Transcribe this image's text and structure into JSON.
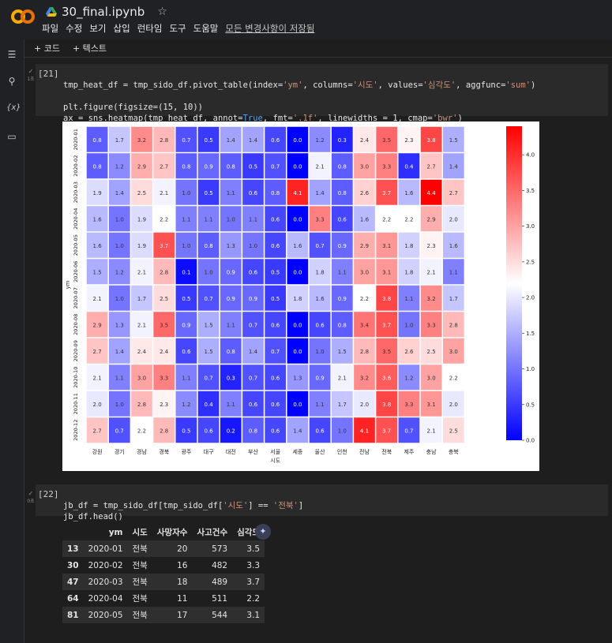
{
  "app": {
    "notebook_title": "30_final.ipynb",
    "menu": [
      "파일",
      "수정",
      "보기",
      "삽입",
      "런타임",
      "도구",
      "도움말"
    ],
    "save_status": "모든 변경사항이 저장됨"
  },
  "toolbar": {
    "code_label": "+ 코드",
    "text_label": "+ 텍스트"
  },
  "cells": [
    {
      "number": "[21]",
      "exec_time": "1초",
      "code_lines": [
        "tmp_heat_df = tmp_sido_df.pivot_table(index='ym', columns='시도', values='심각도', aggfunc='sum')",
        "",
        "plt.figure(figsize=(15, 10))",
        "ax = sns.heatmap(tmp_heat_df, annot=True, fmt='.1f', linewidths = 1, cmap='bwr')"
      ]
    },
    {
      "number": "[22]",
      "exec_time": "0초",
      "code_lines": [
        "jb_df = tmp_sido_df[tmp_sido_df['시도'] == '전북']",
        "jb_df.head()"
      ]
    }
  ],
  "chart_data": {
    "type": "heatmap",
    "xlabel": "시도",
    "ylabel": "ym",
    "x_categories": [
      "강원",
      "경기",
      "경남",
      "경북",
      "광주",
      "대구",
      "대전",
      "부산",
      "서울",
      "세종",
      "울산",
      "인천",
      "전남",
      "전북",
      "제주",
      "충남",
      "충북"
    ],
    "y_categories": [
      "2020-01",
      "2020-02",
      "2020-03",
      "2020-04",
      "2020-05",
      "2020-06",
      "2020-07",
      "2020-08",
      "2020-09",
      "2020-10",
      "2020-11",
      "2020-12"
    ],
    "values": [
      [
        0.8,
        1.7,
        3.2,
        2.8,
        0.7,
        0.5,
        1.4,
        1.4,
        0.6,
        0.0,
        1.2,
        0.3,
        2.4,
        3.5,
        2.3,
        3.8,
        1.5
      ],
      [
        0.8,
        1.2,
        2.9,
        2.7,
        0.8,
        0.9,
        0.8,
        0.5,
        0.7,
        0.0,
        2.1,
        0.8,
        3.0,
        3.3,
        0.4,
        2.7,
        1.4
      ],
      [
        1.9,
        1.4,
        2.5,
        2.1,
        1.0,
        0.5,
        1.1,
        0.6,
        0.8,
        4.1,
        1.4,
        0.8,
        2.6,
        3.7,
        1.6,
        4.4,
        2.7
      ],
      [
        1.6,
        1.0,
        1.9,
        2.2,
        1.1,
        1.1,
        1.0,
        1.1,
        0.6,
        0.0,
        3.3,
        0.6,
        1.6,
        2.2,
        2.2,
        2.9,
        2.0
      ],
      [
        1.6,
        1.0,
        1.9,
        3.7,
        1.0,
        0.8,
        1.3,
        1.0,
        0.6,
        1.6,
        0.7,
        0.9,
        2.9,
        3.1,
        1.8,
        2.3,
        1.6
      ],
      [
        1.5,
        1.2,
        2.1,
        2.8,
        0.1,
        1.0,
        0.9,
        0.6,
        0.5,
        0.0,
        1.8,
        1.1,
        3.0,
        3.1,
        1.8,
        2.1,
        1.1
      ],
      [
        2.1,
        1.0,
        1.7,
        2.5,
        0.5,
        0.7,
        0.9,
        0.9,
        0.5,
        1.8,
        1.6,
        0.9,
        2.2,
        3.8,
        1.1,
        3.2,
        1.7
      ],
      [
        2.9,
        1.3,
        2.1,
        3.5,
        0.9,
        1.5,
        1.1,
        0.7,
        0.6,
        0.0,
        0.6,
        0.8,
        3.4,
        3.7,
        1.0,
        3.3,
        2.8
      ],
      [
        2.7,
        1.4,
        2.4,
        2.4,
        0.6,
        1.5,
        0.8,
        1.4,
        0.7,
        0.0,
        1.0,
        1.5,
        2.8,
        3.5,
        2.6,
        2.5,
        3.0
      ],
      [
        2.1,
        1.1,
        3.0,
        3.3,
        1.1,
        0.7,
        0.3,
        0.7,
        0.6,
        1.3,
        0.9,
        2.1,
        3.2,
        3.6,
        1.2,
        3.0,
        2.2
      ],
      [
        2.0,
        1.0,
        2.8,
        2.3,
        1.2,
        0.4,
        1.1,
        0.6,
        0.6,
        0.0,
        1.1,
        1.7,
        2.0,
        3.8,
        3.3,
        3.1,
        2.0
      ],
      [
        2.7,
        0.7,
        2.2,
        2.8,
        0.5,
        0.6,
        0.2,
        0.8,
        0.6,
        1.4,
        0.6,
        1.0,
        4.1,
        3.7,
        0.7,
        2.1,
        2.5
      ]
    ],
    "colorbar_ticks": [
      "0.0",
      "0.5",
      "1.0",
      "1.5",
      "2.0",
      "2.5",
      "3.0",
      "3.5",
      "4.0"
    ],
    "vmin": 0.0,
    "vmax": 4.4,
    "cmap": "bwr"
  },
  "dataframe": {
    "columns": [
      "ym",
      "시도",
      "사망자수",
      "사고건수",
      "심각도"
    ],
    "rows": [
      {
        "index": "13",
        "ym": "2020-01",
        "sido": "전북",
        "deaths": "20",
        "accidents": "573",
        "severity": "3.5"
      },
      {
        "index": "30",
        "ym": "2020-02",
        "sido": "전북",
        "deaths": "16",
        "accidents": "482",
        "severity": "3.3"
      },
      {
        "index": "47",
        "ym": "2020-03",
        "sido": "전북",
        "deaths": "18",
        "accidents": "489",
        "severity": "3.7"
      },
      {
        "index": "64",
        "ym": "2020-04",
        "sido": "전북",
        "deaths": "11",
        "accidents": "511",
        "severity": "2.2"
      },
      {
        "index": "81",
        "ym": "2020-05",
        "sido": "전북",
        "deaths": "17",
        "accidents": "544",
        "severity": "3.1"
      }
    ]
  },
  "colors": {
    "accent": "#f9ab00",
    "bg": "#1e1e1e",
    "code_bg": "#2a2a2a"
  }
}
